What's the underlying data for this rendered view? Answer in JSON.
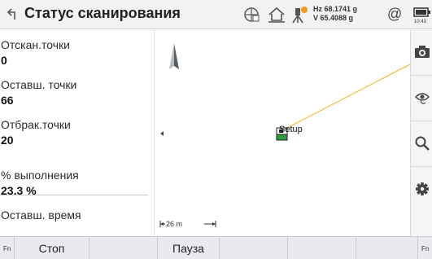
{
  "header": {
    "title": "Статус сканирования",
    "hz": "Hz 68.1741 g",
    "v": "V  65.4088 g",
    "at_symbol": "@",
    "time": "10:43"
  },
  "left_panel": {
    "items": [
      {
        "label": "Отскан.точки",
        "value": "0"
      },
      {
        "label": "Оставш. точки",
        "value": "66"
      },
      {
        "label": "Отбрак.точки",
        "value": "20"
      },
      {
        "label": "% выполнения",
        "value": "23.3 %"
      },
      {
        "label": "Оставш. время",
        "value": ""
      }
    ]
  },
  "map": {
    "station_label": "Setup",
    "scale_label": "26 m",
    "line_color": "#f5b324"
  },
  "right_toolbar": {
    "icons": [
      "camera-icon",
      "eye-icon",
      "search-icon",
      "gear-icon"
    ]
  },
  "bottom_bar": {
    "fn_left": "Fn",
    "fn_right": "Fn",
    "keys": [
      "Стоп",
      "Пауза"
    ]
  },
  "colors": {
    "accent": "#f5b324",
    "station_green": "#2e9c3e"
  }
}
